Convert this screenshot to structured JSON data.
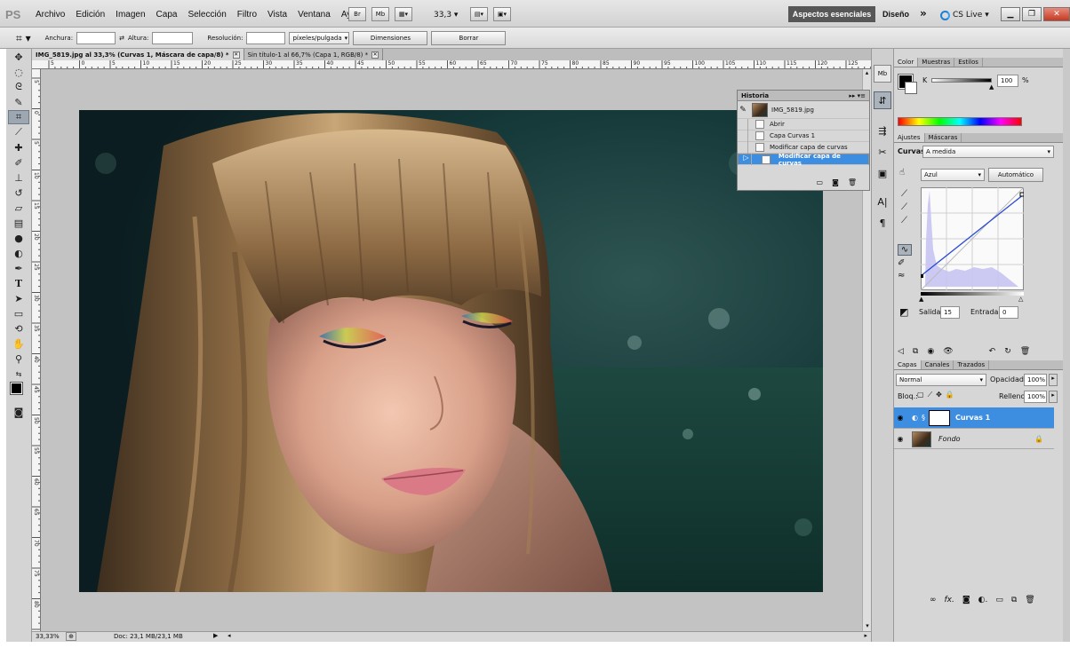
{
  "app": {
    "logo": "PS",
    "menus": [
      "Archivo",
      "Edición",
      "Imagen",
      "Capa",
      "Selección",
      "Filtro",
      "Vista",
      "Ventana",
      "Ayuda"
    ],
    "bridge_label": "Br",
    "minibridge_label": "Mb",
    "zoom": "33,3",
    "workspace_active": "Aspectos esenciales",
    "workspace_other": "Diseño",
    "more": "»",
    "cs_live": "CS Live"
  },
  "options_bar": {
    "width_label": "Anchura:",
    "height_label": "Altura:",
    "resolution_label": "Resolución:",
    "units_value": "píxeles/pulgada",
    "dimensions_button": "Dimensiones",
    "clear_button": "Borrar"
  },
  "document": {
    "tabs": [
      {
        "title": "IMG_5819.jpg al 33,3% (Curvas 1, Máscara de capa/8) *",
        "close": "✕"
      },
      {
        "title": "Sin título-1 al 66,7% (Capa 1, RGB/8) *",
        "close": "✕"
      }
    ],
    "ruler_top": [
      "5",
      "0",
      "5",
      "10",
      "15",
      "20",
      "25",
      "30",
      "35",
      "40",
      "45",
      "50",
      "55",
      "60",
      "65",
      "70",
      "75",
      "80",
      "85",
      "90",
      "95",
      "100",
      "105",
      "110",
      "115",
      "120",
      "125"
    ],
    "ruler_left": [
      "5",
      "0",
      "5",
      "10",
      "15",
      "20",
      "25",
      "30",
      "35",
      "40",
      "45",
      "50",
      "55",
      "60",
      "65",
      "70",
      "75",
      "80",
      "85"
    ],
    "status_zoom": "33,33%",
    "status_doc": "Doc: 23,1 MB/23,1 MB"
  },
  "history": {
    "title": "Historia",
    "snapshot": "IMG_5819.jpg",
    "items": [
      "Abrir",
      "Capa Curvas 1",
      "Modificar capa de curvas",
      "Modificar capa de curvas"
    ],
    "selected_index": 3
  },
  "color_panel": {
    "tabs": [
      "Color",
      "Muestras",
      "Estilos"
    ],
    "channel": "K",
    "value": "100",
    "unit": "%"
  },
  "adjustments": {
    "tabs": [
      "Ajustes",
      "Máscaras"
    ],
    "type": "Curvas",
    "preset": "A medida",
    "channel": "Azul",
    "auto_button": "Automático",
    "output_label": "Salida:",
    "output_value": "15",
    "input_label": "Entrada:",
    "input_value": "0"
  },
  "layers": {
    "tabs": [
      "Capas",
      "Canales",
      "Trazados"
    ],
    "blend_mode": "Normal",
    "opacity_label": "Opacidad:",
    "opacity_value": "100%",
    "lock_label": "Bloq.:",
    "fill_label": "Relleno:",
    "fill_value": "100%",
    "items": [
      {
        "name": "Curvas 1",
        "selected": true
      },
      {
        "name": "Fondo",
        "selected": false
      }
    ]
  },
  "colors": {
    "selection": "#3d8de0",
    "workspace_active_bg": "#575757",
    "canvas_bg": "#c3c3c3"
  }
}
